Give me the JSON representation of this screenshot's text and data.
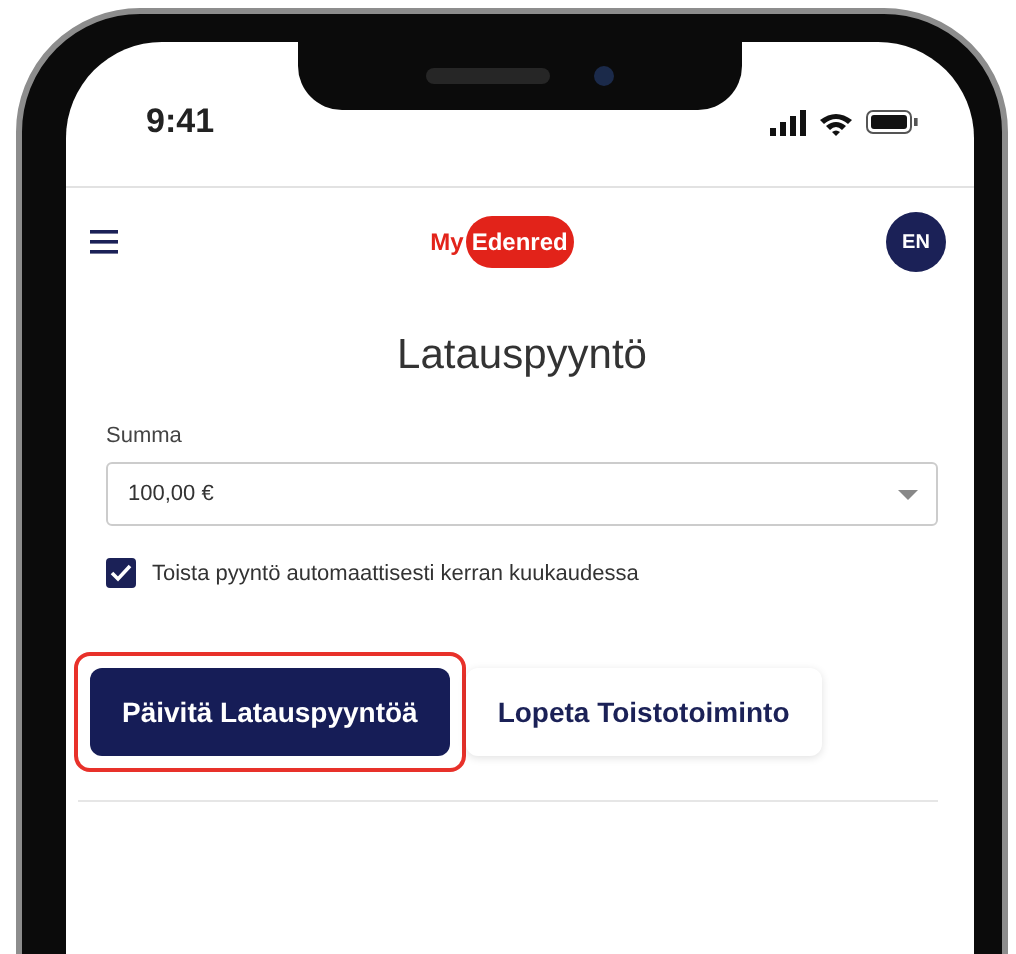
{
  "status_bar": {
    "time": "9:41"
  },
  "header": {
    "logo": {
      "prefix": "My",
      "name": "Edenred"
    },
    "language": "EN"
  },
  "title": "Latauspyyntö",
  "amount": {
    "label": "Summa",
    "value": "100,00 €"
  },
  "repeat": {
    "label": "Toista pyyntö automaattisesti kerran kuukaudessa",
    "checked": true
  },
  "buttons": [
    {
      "label": "Päivitä Latauspyyntöä",
      "kind": "primary",
      "highlighted": true
    },
    {
      "label": "Lopeta Toistotoiminto",
      "kind": "secondary",
      "highlighted": false
    }
  ]
}
